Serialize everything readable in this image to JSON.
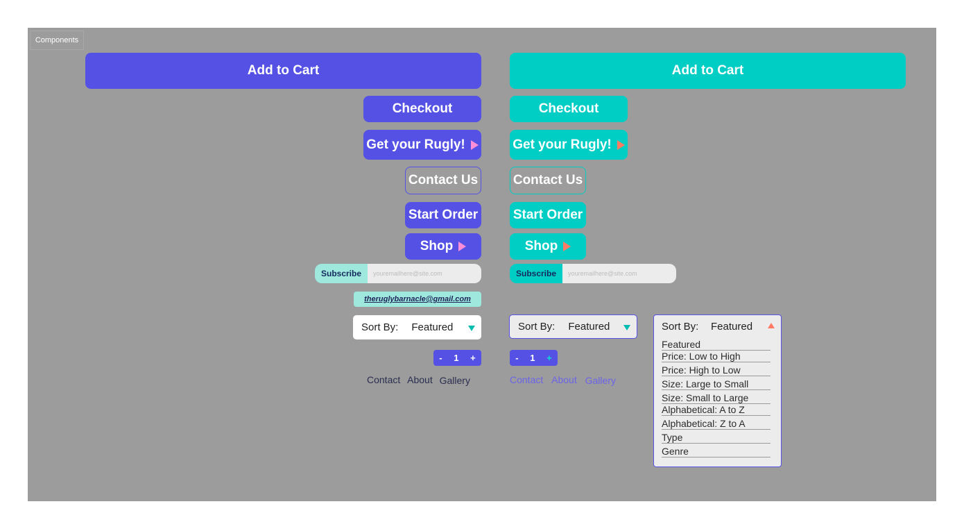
{
  "frame": {
    "label": "Components"
  },
  "colors": {
    "purple": "#5551e5",
    "teal": "#00cec4",
    "subscribe_mint": "#9ee8de",
    "coral": "#ff7b63",
    "pink": "#ff8ed8",
    "background": "#9c9c9c"
  },
  "purple_set": {
    "add_to_cart": "Add to Cart",
    "checkout": "Checkout",
    "get_rugly": "Get your Rugly!",
    "contact_us": "Contact Us",
    "start_order": "Start Order",
    "shop": "Shop",
    "subscribe": {
      "label": "Subscribe",
      "placeholder": "youremailhere@site.com"
    },
    "email": "theruglybarnacle@gmail.com",
    "sort": {
      "label": "Sort By:",
      "value": "Featured"
    },
    "qty": {
      "minus": "-",
      "value": "1",
      "plus": "+"
    },
    "nav": [
      "Contact",
      "About",
      "Gallery"
    ]
  },
  "teal_set": {
    "add_to_cart": "Add to Cart",
    "checkout": "Checkout",
    "get_rugly": "Get your Rugly!",
    "contact_us": "Contact Us",
    "start_order": "Start Order",
    "shop": "Shop",
    "subscribe": {
      "label": "Subscribe",
      "placeholder": "youremailhere@site.com"
    },
    "sort": {
      "label": "Sort By:",
      "value": "Featured"
    },
    "qty": {
      "minus": "-",
      "value": "1",
      "plus": "+"
    },
    "nav": [
      "Contact",
      "About",
      "Gallery"
    ]
  },
  "sort_dropdown": {
    "label": "Sort By:",
    "value": "Featured",
    "options": [
      "Featured",
      "Price: Low to High",
      "Price: High to Low",
      "Size: Large to Small",
      "Size: Small to Large",
      "Alphabetical: A to Z",
      "Alphabetical: Z to A",
      "Type",
      "Genre"
    ]
  },
  "icons": {
    "play": "play-triangle-icon",
    "dropdown_closed": "caret-down-icon",
    "dropdown_open": "caret-up-icon"
  }
}
